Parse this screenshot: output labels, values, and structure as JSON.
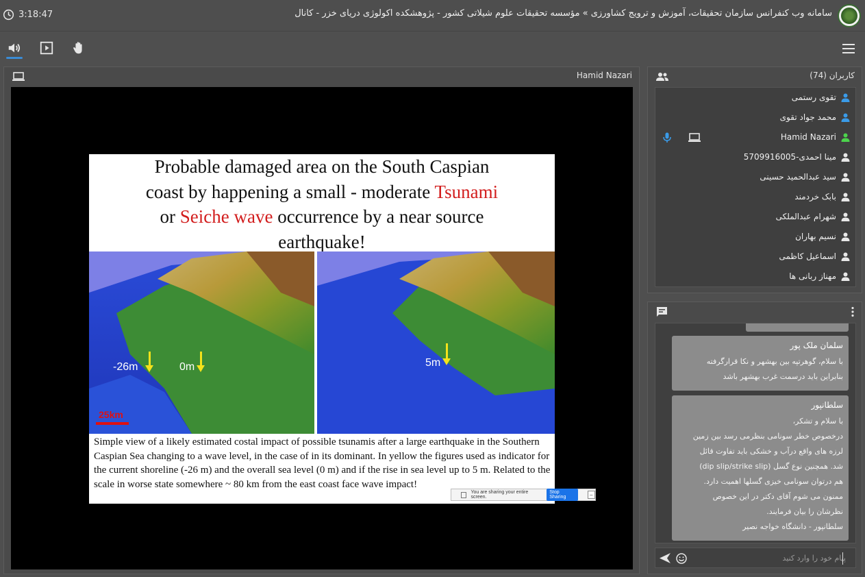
{
  "header": {
    "clock": "3:18:47",
    "title": "سامانه وب کنفرانس سازمان تحقیقات، آموزش و ترویج کشاورزی » مؤسسه تحقیقات علوم شیلاتی کشور - پژوهشکده اکولوژی دریای خزر - کانال"
  },
  "toolbar": {
    "icons": [
      "speaker-icon",
      "play-screen-icon",
      "raise-hand-icon",
      "menu-icon"
    ]
  },
  "presentation": {
    "presenter": "Hamid Nazari",
    "slide": {
      "title_line1": "Probable damaged area on the South Caspian",
      "title_line2_a": "coast by happening a small - moderate ",
      "title_line2_b": "Tsunami",
      "title_line3_a": "or ",
      "title_line3_b": "Seiche wave",
      "title_line3_c": " occurrence by a near source",
      "title_line4": "earthquake!",
      "label_left_1": "-26m",
      "label_left_2": "0m",
      "label_right": "5m",
      "scale": "25km",
      "caption": "Simple view of a likely estimated costal impact of possible tsunamis after a large earthquake in the Southern Caspian Sea changing to a wave level, in the case of in its dominant. In yellow the figures used as indicator for the current shoreline (-26 m) and the overall sea level (0 m) and if the rise in sea level up to 5 m. Related to the scale in worse state somewhere ~ 80 km from the east coast face wave impact!"
    },
    "share_bar": {
      "text": "You are sharing your entire screen.",
      "stop": "Stop Sharing",
      "hide": "_"
    }
  },
  "users": {
    "title": "کاربران (74)",
    "list": [
      {
        "name": "تقوی رستمی",
        "color": "#3a9be8"
      },
      {
        "name": "محمد جواد تقوی",
        "color": "#3a9be8"
      },
      {
        "name": "Hamid Nazari",
        "color": "#4cd44c"
      },
      {
        "name": "مینا احمدی-5709916005",
        "color": "#e8e8e8"
      },
      {
        "name": "سید عبدالحمید حسینی",
        "color": "#e8e8e8"
      },
      {
        "name": "بابک خردمند",
        "color": "#e8e8e8"
      },
      {
        "name": "شهرام عبدالملکی",
        "color": "#e8e8e8"
      },
      {
        "name": "نسیم بهاران",
        "color": "#e8e8e8"
      },
      {
        "name": "اسماعیل کاظمی",
        "color": "#e8e8e8"
      },
      {
        "name": "مهناز ربانی ها",
        "color": "#e8e8e8"
      }
    ]
  },
  "chat": {
    "messages": [
      {
        "author": "سلمان ملک پور",
        "lines": [
          "با سلام، گوهرتپه بین بهشهر و نکا قرارگرفته",
          "بنابراین باید درسمت غرب بهشهر باشد"
        ]
      },
      {
        "author": "سلطانپور",
        "lines": [
          "با سلام و تشکر،",
          "درخصوص خطر سونامی بنظرمی رسد بین زمین",
          "لرزه های واقع درآب و خشکی باید تفاوت قائل",
          "شد. همچنین نوع گسل (dip slip/strike slip)",
          "هم درتوان سونامی خیزی گسلها اهمیت دارد.",
          "ممنون می شوم آقای دکتر در این خصوص",
          "نظرشان را بیان فرمایند.",
          "سلطانپور - دانشگاه خواجه نصیر"
        ]
      }
    ],
    "placeholder": "پیام خود را وارد کنید"
  }
}
